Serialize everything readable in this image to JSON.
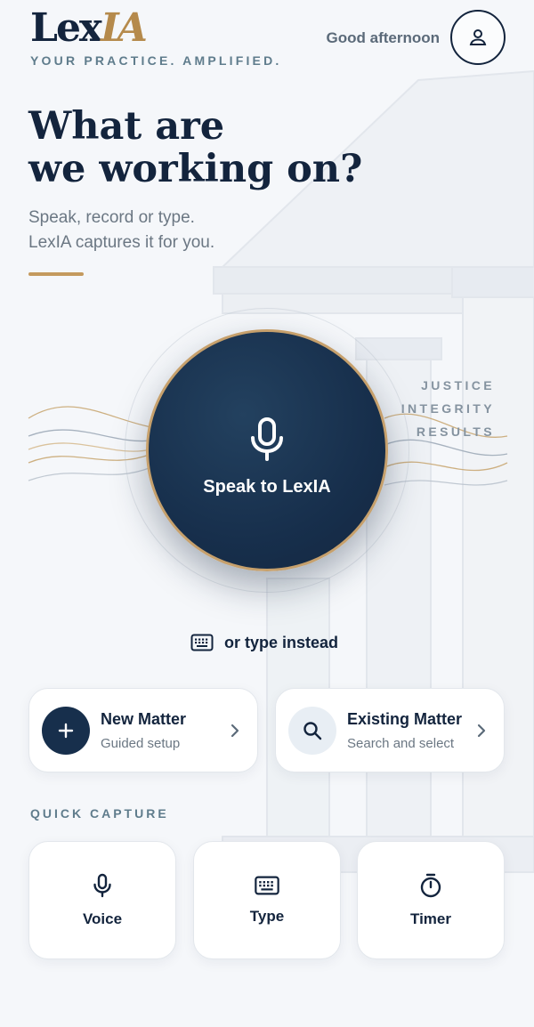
{
  "colors": {
    "navy": "#13243d",
    "gold": "#c49a5e",
    "muted": "#6b7783",
    "label": "#5f7c8c"
  },
  "header": {
    "logo_main": "Lex",
    "logo_accent": "IA",
    "tagline": "YOUR PRACTICE. AMPLIFIED.",
    "greeting": "Good afternoon",
    "profile_icon": "user-icon"
  },
  "hero": {
    "title_line1": "What are",
    "title_line2": "we working on?",
    "subtitle_line1": "Speak, record or type.",
    "subtitle_line2": "LexIA captures it for you."
  },
  "slogan": [
    "JUSTICE",
    "INTEGRITY",
    "RESULTS"
  ],
  "mic": {
    "label": "Speak to LexIA",
    "icon": "microphone-icon"
  },
  "type_instead": {
    "label": "or type instead",
    "icon": "keyboard-icon"
  },
  "matters": [
    {
      "title": "New Matter",
      "subtitle": "Guided setup",
      "icon": "plus-icon"
    },
    {
      "title": "Existing Matter",
      "subtitle": "Search and select",
      "icon": "search-icon"
    }
  ],
  "quick_capture": {
    "heading": "QUICK CAPTURE",
    "items": [
      {
        "label": "Voice",
        "icon": "microphone-icon"
      },
      {
        "label": "Type",
        "icon": "keyboard-icon"
      },
      {
        "label": "Timer",
        "icon": "stopwatch-icon"
      }
    ]
  }
}
